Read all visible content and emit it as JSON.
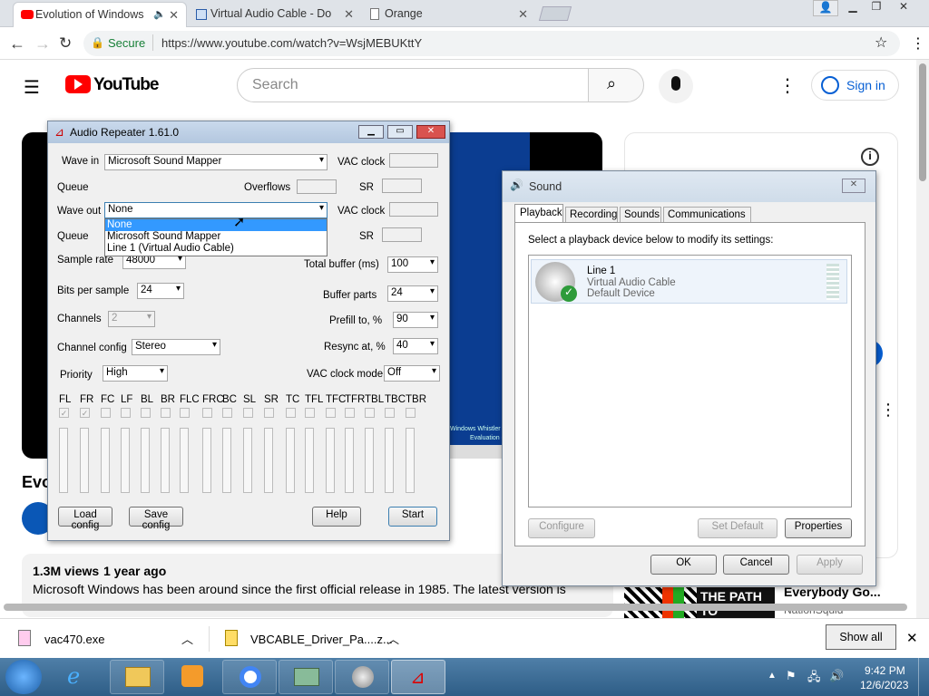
{
  "browser": {
    "tabs": [
      {
        "label": "Evolution of Windows"
      },
      {
        "label": "Virtual Audio Cable - Do"
      },
      {
        "label": "Orange"
      }
    ],
    "secure_label": "Secure",
    "url": "https://www.youtube.com/watch?v=WsjMEBUKttY"
  },
  "youtube": {
    "logo": "YouTube",
    "search_placeholder": "Search",
    "sign_in": "Sign in",
    "title_partial": "Evo",
    "views": "1.3M views",
    "age": "1 year ago",
    "description": "Microsoft Windows has been around since the first official release in 1985. The latest version is",
    "sidebar_video_title": "Everybody Go...",
    "sidebar_channel": "NationSquid",
    "thumb_text": "THE PATH TO",
    "video_frame_text1": "Windows Whistler Pr",
    "video_frame_text2": "Evaluation copy. B"
  },
  "repeater": {
    "title": "Audio Repeater 1.61.0",
    "wave_in_label": "Wave in",
    "wave_in_value": "Microsoft Sound Mapper",
    "vac_clock_label": "VAC clock",
    "queue_label": "Queue",
    "overflows_label": "Overflows",
    "sr_label": "SR",
    "wave_out_label": "Wave out",
    "wave_out_value": "None",
    "dropdown_options": [
      "None",
      "Microsoft Sound Mapper",
      "Line 1 (Virtual Audio Cable)"
    ],
    "sample_rate_label": "Sample rate",
    "sample_rate_value": "48000",
    "total_buffer_label": "Total buffer (ms)",
    "total_buffer_value": "100",
    "bits_label": "Bits per sample",
    "bits_value": "24",
    "buffer_parts_label": "Buffer parts",
    "buffer_parts_value": "24",
    "channels_label": "Channels",
    "channels_value": "2",
    "prefill_label": "Prefill to, %",
    "prefill_value": "90",
    "channel_config_label": "Channel config",
    "channel_config_value": "Stereo",
    "resync_label": "Resync at, %",
    "resync_value": "40",
    "priority_label": "Priority",
    "priority_value": "High",
    "vac_clock_mode_label": "VAC clock mode",
    "vac_clock_mode_value": "Off",
    "channels_list": [
      "FL",
      "FR",
      "FC",
      "LF",
      "BL",
      "BR",
      "FLC",
      "FRC",
      "BC",
      "SL",
      "SR",
      "TC",
      "TFL",
      "TFC",
      "TFR",
      "TBL",
      "TBC",
      "TBR"
    ],
    "load_config": "Load config",
    "save_config": "Save config",
    "help": "Help",
    "start": "Start"
  },
  "sound": {
    "title": "Sound",
    "tabs": [
      "Playback",
      "Recording",
      "Sounds",
      "Communications"
    ],
    "instruction": "Select a playback device below to modify its settings:",
    "device_name": "Line 1",
    "device_desc": "Virtual Audio Cable",
    "device_status": "Default Device",
    "configure": "Configure",
    "set_default": "Set Default",
    "properties": "Properties",
    "ok": "OK",
    "cancel": "Cancel",
    "apply": "Apply"
  },
  "downloads": [
    {
      "name": "vac470.exe"
    },
    {
      "name": "VBCABLE_Driver_Pa....z..."
    }
  ],
  "show_all": "Show all",
  "clock": {
    "time": "9:42 PM",
    "date": "12/6/2023"
  }
}
